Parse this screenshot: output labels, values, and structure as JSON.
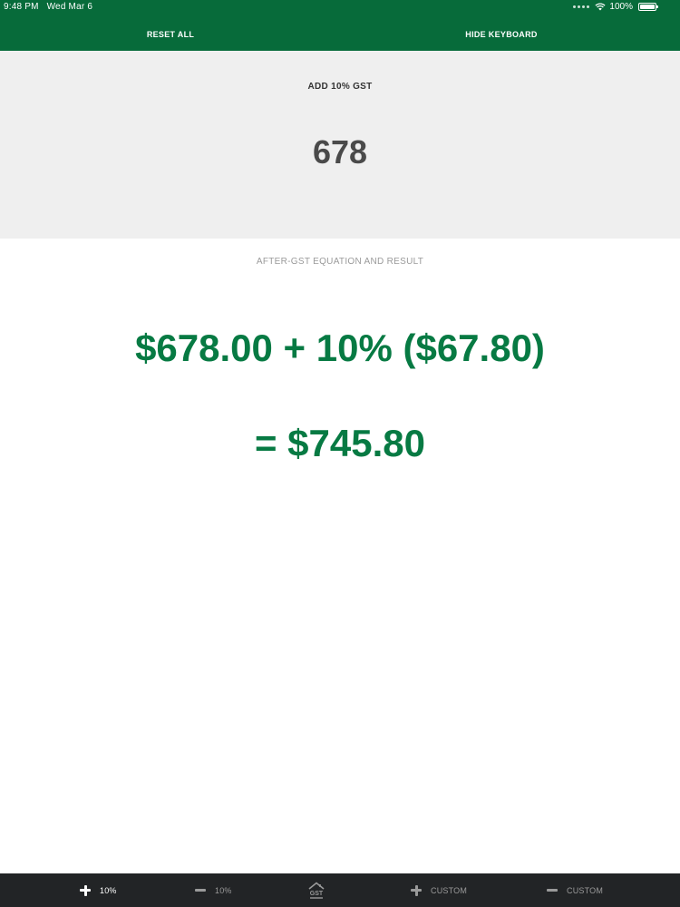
{
  "status_bar": {
    "time": "9:48 PM",
    "date": "Wed Mar 6",
    "battery": "100%"
  },
  "nav": {
    "reset_label": "RESET ALL",
    "hide_keyboard_label": "HIDE KEYBOARD"
  },
  "input": {
    "title": "ADD 10% GST",
    "value": "678"
  },
  "result": {
    "caption": "AFTER-GST EQUATION AND RESULT",
    "equation": "$678.00 + 10% ($67.80)",
    "total": "= $745.80"
  },
  "tabbar": {
    "tabs": [
      {
        "label": "10%",
        "icon": "plus-icon",
        "active": true
      },
      {
        "label": "10%",
        "icon": "minus-icon",
        "active": false
      },
      {
        "label": "GST",
        "icon": "gst-house-icon",
        "active": false
      },
      {
        "label": "CUSTOM",
        "icon": "plus-icon",
        "active": false
      },
      {
        "label": "CUSTOM",
        "icon": "minus-icon",
        "active": false
      }
    ]
  },
  "colors": {
    "brand_green": "#076b3a",
    "result_green": "#077a43",
    "panel_gray": "#efefef",
    "tabbar_dark": "#222426"
  }
}
